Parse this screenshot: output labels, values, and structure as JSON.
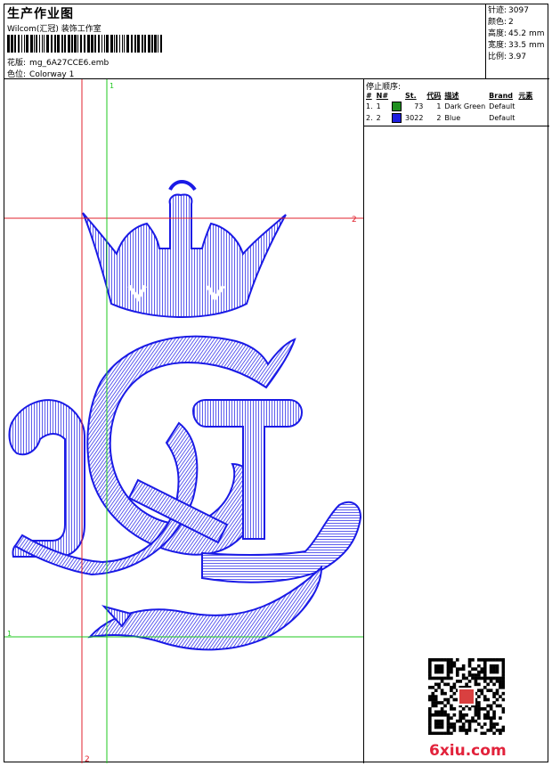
{
  "header": {
    "title": "生产作业图",
    "subtitle": "Wilcom(汇冠) 装饰工作室",
    "design_label": "花版:",
    "design_file": "mg_6A27CCE6.emb",
    "colorway_label": "色位:",
    "colorway": "Colorway 1"
  },
  "stats": [
    {
      "label": "针迹:",
      "value": "3097"
    },
    {
      "label": "颜色:",
      "value": "2"
    },
    {
      "label": "高度:",
      "value": "45.2 mm"
    },
    {
      "label": "宽度:",
      "value": "33.5 mm"
    },
    {
      "label": "比例:",
      "value": "3.97"
    }
  ],
  "stop_sequence": {
    "title": "停止顺序:",
    "headers": [
      "#",
      "N#",
      "St.",
      "代码",
      "描述",
      "Brand",
      "元素"
    ],
    "rows": [
      {
        "num": "1.",
        "n": "1",
        "color": "#1f8f1f",
        "st": "73",
        "code": "1",
        "desc": "Dark Green",
        "brand": "Default"
      },
      {
        "num": "2.",
        "n": "2",
        "color": "#1f1fe0",
        "st": "3022",
        "code": "2",
        "desc": "Blue",
        "brand": "Default"
      }
    ]
  },
  "guides": {
    "marker_1_top": "1",
    "marker_2_right": "2",
    "marker_1_left": "1",
    "marker_2_bottom": "2",
    "red": "#e0202c",
    "green": "#1fc81f"
  },
  "watermark": "6xiu.com",
  "stitch_color": "#1a1ae6"
}
